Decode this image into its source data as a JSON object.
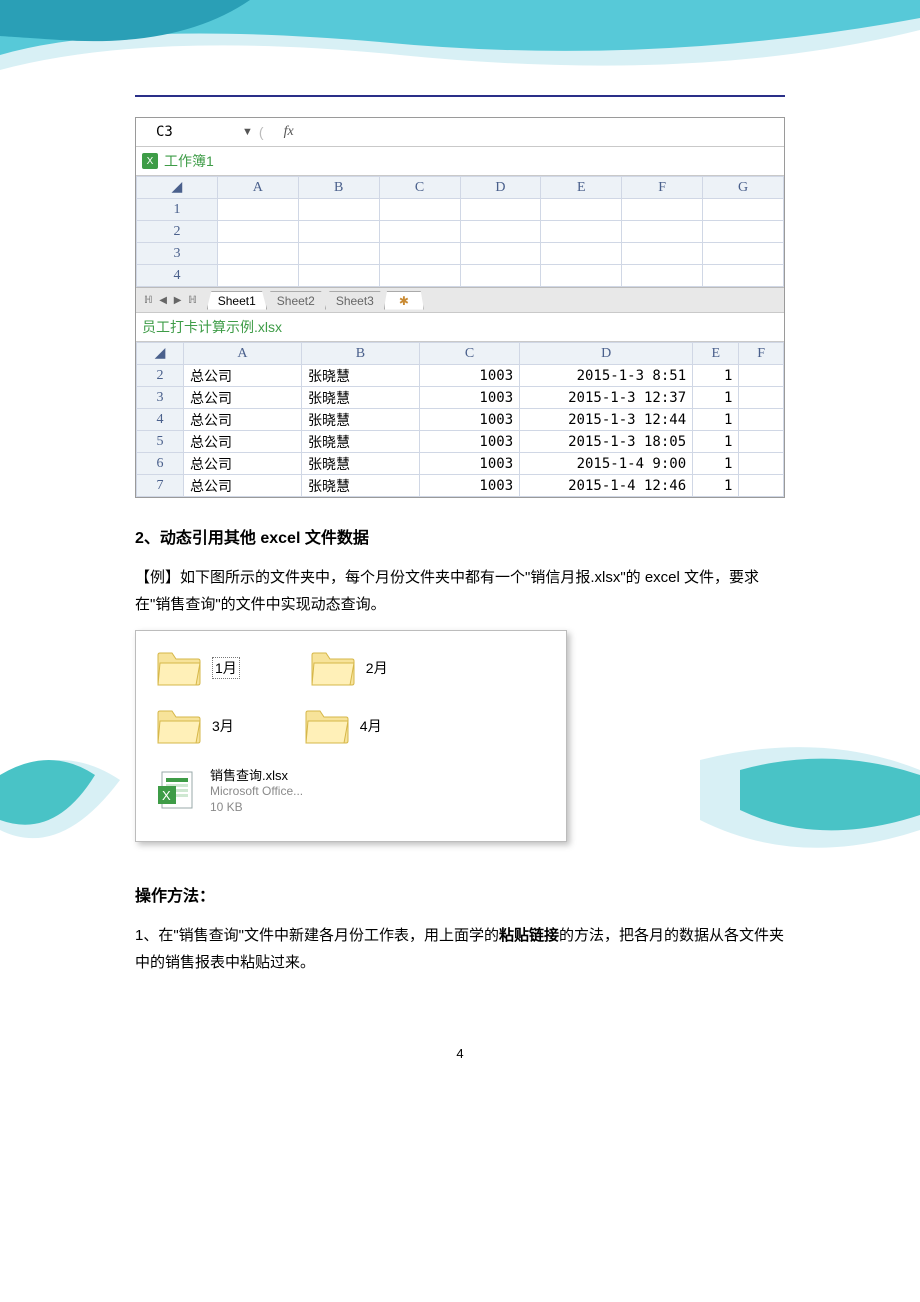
{
  "excel": {
    "namebox": "C3",
    "fx_label": "fx",
    "workbook1_title": "工作簿1",
    "cols1": [
      "A",
      "B",
      "C",
      "D",
      "E",
      "F",
      "G"
    ],
    "rows1": [
      "1",
      "2",
      "3",
      "4"
    ],
    "tabs": {
      "sheet1": "Sheet1",
      "sheet2": "Sheet2",
      "sheet3": "Sheet3"
    },
    "workbook2_title": "员工打卡计算示例.xlsx",
    "cols2": [
      "A",
      "B",
      "C",
      "D",
      "E",
      "F"
    ],
    "data_rows": [
      {
        "n": "2",
        "a": "总公司",
        "b": "张晓慧",
        "c": "1003",
        "d": "2015-1-3 8:51",
        "e": "1"
      },
      {
        "n": "3",
        "a": "总公司",
        "b": "张晓慧",
        "c": "1003",
        "d": "2015-1-3 12:37",
        "e": "1"
      },
      {
        "n": "4",
        "a": "总公司",
        "b": "张晓慧",
        "c": "1003",
        "d": "2015-1-3 12:44",
        "e": "1"
      },
      {
        "n": "5",
        "a": "总公司",
        "b": "张晓慧",
        "c": "1003",
        "d": "2015-1-3 18:05",
        "e": "1"
      },
      {
        "n": "6",
        "a": "总公司",
        "b": "张晓慧",
        "c": "1003",
        "d": "2015-1-4 9:00",
        "e": "1"
      },
      {
        "n": "7",
        "a": "总公司",
        "b": "张晓慧",
        "c": "1003",
        "d": "2015-1-4 12:46",
        "e": "1"
      }
    ]
  },
  "text": {
    "heading1": "2、动态引用其他 excel 文件数据",
    "para1": "【例】如下图所示的文件夹中，每个月份文件夹中都有一个\"销信月报.xlsx\"的 excel 文件，要求在\"销售查询\"的文件中实现动态查询。",
    "heading2": "操作方法：",
    "para2a": "1、在\"销售查询\"文件中新建各月份工作表，用上面学的",
    "para2b": "粘贴链接",
    "para2c": "的方法，把各月的数据从各文件夹中的销售报表中粘贴过来。"
  },
  "folders": {
    "m1": "1月",
    "m2": "2月",
    "m3": "3月",
    "m4": "4月",
    "file_name": "销售查询.xlsx",
    "file_type": "Microsoft Office...",
    "file_size": "10 KB"
  },
  "page_number": "4"
}
